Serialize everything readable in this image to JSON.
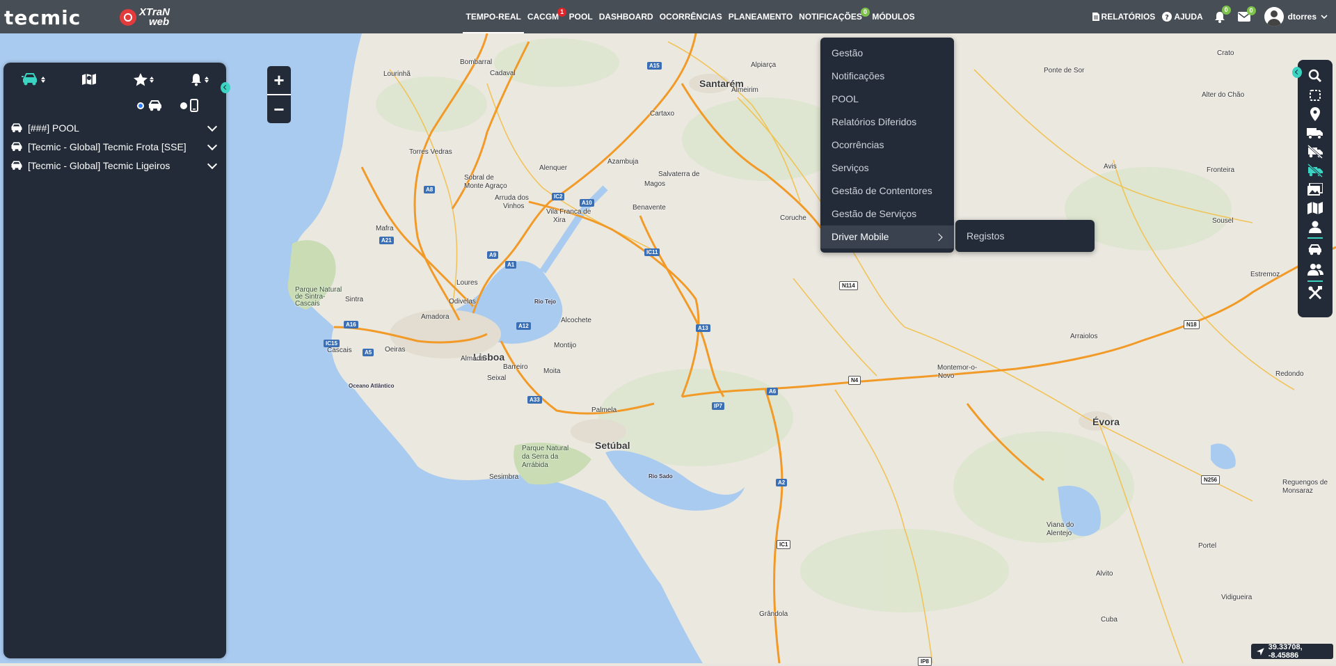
{
  "app": {
    "brand_primary": "tecmic",
    "brand_secondary_top": "XTraN",
    "brand_secondary_bottom": "web",
    "accent_color": "#3bd3c2",
    "panel_color": "#232b38"
  },
  "topnav": {
    "items": [
      {
        "label": "TEMPO-REAL",
        "active": true,
        "badge": ""
      },
      {
        "label": "CACGM",
        "active": false,
        "badge": "1"
      },
      {
        "label": "POOL",
        "active": false,
        "badge": ""
      },
      {
        "label": "DASHBOARD",
        "active": false,
        "badge": ""
      },
      {
        "label": "OCORRÊNCIAS",
        "active": false,
        "badge": ""
      },
      {
        "label": "PLANEAMENTO",
        "active": false,
        "badge": ""
      },
      {
        "label": "NOTIFICAÇÕES",
        "active": false,
        "badge": "0"
      },
      {
        "label": "MÓDULOS",
        "active": false,
        "badge": ""
      }
    ],
    "reports_label": "RELATÓRIOS",
    "help_label": "AJUDA",
    "alerts_badge": "0",
    "messages_badge": "0",
    "username": "dtorres"
  },
  "leftpanel": {
    "tabs": [
      "vehicles-icon",
      "map-icon",
      "star-icon",
      "bell-icon"
    ],
    "radio_options": [
      "vehicles",
      "mobile"
    ],
    "fleets": [
      {
        "label": "[###] POOL"
      },
      {
        "label": "[Tecmic - Global] Tecmic Frota [SSE]"
      },
      {
        "label": "[Tecmic - Global] Tecmic Ligeiros"
      }
    ]
  },
  "zoom": {
    "in": "+",
    "out": "−"
  },
  "modules_menu": {
    "items": [
      {
        "label": "Gestão"
      },
      {
        "label": "Notificações"
      },
      {
        "label": "POOL"
      },
      {
        "label": "Relatórios Diferidos"
      },
      {
        "label": "Ocorrências"
      },
      {
        "label": "Serviços"
      },
      {
        "label": "Gestão de Contentores"
      },
      {
        "label": "Gestão de Serviços"
      },
      {
        "label": "Driver Mobile"
      }
    ],
    "submenu": [
      {
        "label": "Registos"
      }
    ]
  },
  "right_toolbar": {
    "tools": [
      "search-icon",
      "select-area-icon",
      "location-pin-icon",
      "truck-icon",
      "truck-off-icon",
      "route-off-icon",
      "gallery-icon",
      "map-layers-icon",
      "person-icon",
      "cars-icon",
      "users-icon",
      "tools-icon"
    ]
  },
  "coords": {
    "text": "39.33708, -8.45886"
  },
  "map": {
    "cities": [
      {
        "name": "Santarém",
        "cls": "big"
      },
      {
        "name": "Lisboa",
        "cls": "big"
      },
      {
        "name": "Setúbal",
        "cls": "big"
      },
      {
        "name": "Évora",
        "cls": "big"
      },
      {
        "name": "Bombarral",
        "cls": ""
      },
      {
        "name": "Cadaval",
        "cls": ""
      },
      {
        "name": "Lourinhã",
        "cls": ""
      },
      {
        "name": "Alpiarça",
        "cls": ""
      },
      {
        "name": "Almeirim",
        "cls": ""
      },
      {
        "name": "Cartaxo",
        "cls": ""
      },
      {
        "name": "Torres Vedras",
        "cls": ""
      },
      {
        "name": "Alenquer",
        "cls": ""
      },
      {
        "name": "Azambuja",
        "cls": ""
      },
      {
        "name": "Sobral de",
        "cls": ""
      },
      {
        "name": "Monte Agraço",
        "cls": ""
      },
      {
        "name": "Arruda dos",
        "cls": ""
      },
      {
        "name": "Vinhos",
        "cls": ""
      },
      {
        "name": "Salvaterra de",
        "cls": ""
      },
      {
        "name": "Magos",
        "cls": ""
      },
      {
        "name": "Vila Franca de",
        "cls": ""
      },
      {
        "name": "Xira",
        "cls": ""
      },
      {
        "name": "Benavente",
        "cls": ""
      },
      {
        "name": "Coruche",
        "cls": ""
      },
      {
        "name": "Mafra",
        "cls": ""
      },
      {
        "name": "Loures",
        "cls": ""
      },
      {
        "name": "Odivelas",
        "cls": ""
      },
      {
        "name": "Sintra",
        "cls": ""
      },
      {
        "name": "Amadora",
        "cls": ""
      },
      {
        "name": "Cascais",
        "cls": ""
      },
      {
        "name": "Oeiras",
        "cls": ""
      },
      {
        "name": "Almada",
        "cls": ""
      },
      {
        "name": "Barreiro",
        "cls": ""
      },
      {
        "name": "Seixal",
        "cls": ""
      },
      {
        "name": "Moita",
        "cls": ""
      },
      {
        "name": "Montijo",
        "cls": ""
      },
      {
        "name": "Alcochete",
        "cls": ""
      },
      {
        "name": "Palmela",
        "cls": ""
      },
      {
        "name": "Sesimbra",
        "cls": ""
      },
      {
        "name": "Ponte de Sor",
        "cls": ""
      },
      {
        "name": "Crato",
        "cls": ""
      },
      {
        "name": "Alter do Chão",
        "cls": ""
      },
      {
        "name": "Avis",
        "cls": ""
      },
      {
        "name": "Fronteira",
        "cls": ""
      },
      {
        "name": "Sousel",
        "cls": ""
      },
      {
        "name": "Estremoz",
        "cls": ""
      },
      {
        "name": "Arraiolos",
        "cls": ""
      },
      {
        "name": "Montemor-o-",
        "cls": ""
      },
      {
        "name": "Novo",
        "cls": ""
      },
      {
        "name": "Redondo",
        "cls": ""
      },
      {
        "name": "Reguengos de",
        "cls": ""
      },
      {
        "name": "Monsaraz",
        "cls": ""
      },
      {
        "name": "Viana do",
        "cls": ""
      },
      {
        "name": "Alentejo",
        "cls": ""
      },
      {
        "name": "Portel",
        "cls": ""
      },
      {
        "name": "Alvito",
        "cls": ""
      },
      {
        "name": "Vidigueira",
        "cls": ""
      },
      {
        "name": "Cuba",
        "cls": ""
      },
      {
        "name": "Grândola",
        "cls": ""
      },
      {
        "name": "Parque Natural",
        "cls": "green"
      },
      {
        "name": "de Sintra-",
        "cls": "green"
      },
      {
        "name": "Cascais",
        "cls": "green"
      },
      {
        "name": "Parque Natural",
        "cls": "green"
      },
      {
        "name": "da Serra da",
        "cls": "green"
      },
      {
        "name": "Arrábida",
        "cls": "green"
      },
      {
        "name": "Rio Tejo",
        "cls": "water"
      },
      {
        "name": "Rio Sado",
        "cls": "water"
      },
      {
        "name": "Oceano Atlântico",
        "cls": "water"
      }
    ],
    "shields": [
      {
        "name": "A15",
        "cls": ""
      },
      {
        "name": "A8",
        "cls": ""
      },
      {
        "name": "IC2",
        "cls": ""
      },
      {
        "name": "A10",
        "cls": ""
      },
      {
        "name": "A21",
        "cls": ""
      },
      {
        "name": "A9",
        "cls": ""
      },
      {
        "name": "A1",
        "cls": ""
      },
      {
        "name": "IC11",
        "cls": ""
      },
      {
        "name": "A16",
        "cls": ""
      },
      {
        "name": "IC15",
        "cls": ""
      },
      {
        "name": "A5",
        "cls": ""
      },
      {
        "name": "A12",
        "cls": ""
      },
      {
        "name": "A13",
        "cls": ""
      },
      {
        "name": "A33",
        "cls": ""
      },
      {
        "name": "IP7",
        "cls": ""
      },
      {
        "name": "A6",
        "cls": ""
      },
      {
        "name": "A2",
        "cls": ""
      },
      {
        "name": "IC1",
        "cls": "white"
      },
      {
        "name": "N114",
        "cls": "white"
      },
      {
        "name": "N4",
        "cls": "white"
      },
      {
        "name": "N18",
        "cls": "white"
      },
      {
        "name": "N256",
        "cls": "white"
      },
      {
        "name": "IP8",
        "cls": "white"
      }
    ]
  }
}
